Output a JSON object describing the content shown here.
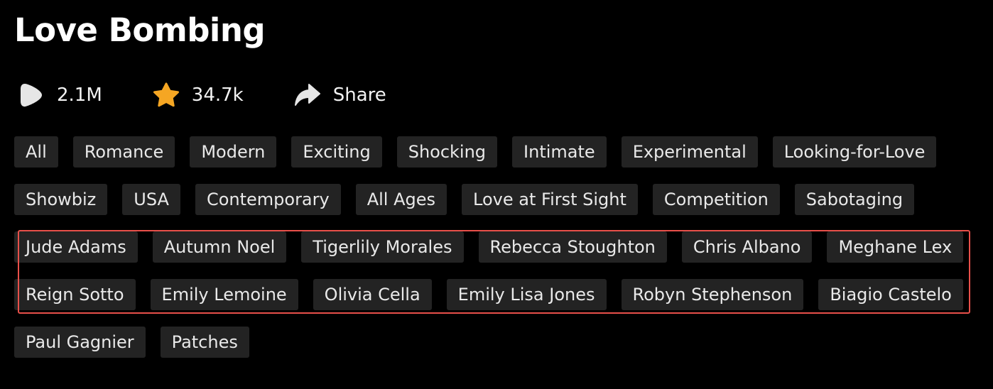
{
  "title": "Love Bombing",
  "stats": {
    "plays": {
      "icon": "play-icon",
      "value": "2.1M"
    },
    "favorites": {
      "icon": "star-icon",
      "value": "34.7k",
      "color": "#f5a623"
    },
    "share": {
      "icon": "share-icon",
      "label": "Share"
    }
  },
  "tag_rows": [
    [
      "All",
      "Romance",
      "Modern",
      "Exciting",
      "Shocking",
      "Intimate",
      "Experimental",
      "Looking-for-Love"
    ],
    [
      "Showbiz",
      "USA",
      "Contemporary",
      "All Ages",
      "Love at First Sight",
      "Competition",
      "Sabotaging"
    ],
    [
      "Jude Adams",
      "Autumn Noel",
      "Tigerlily Morales",
      "Rebecca Stoughton",
      "Chris Albano",
      "Meghane Lex"
    ],
    [
      "Reign Sotto",
      "Emily Lemoine",
      "Olivia Cella",
      "Emily Lisa Jones",
      "Robyn Stephenson",
      "Biagio Castelo"
    ],
    [
      "Paul Gagnier",
      "Patches"
    ]
  ],
  "highlight": {
    "rows": [
      2,
      3
    ],
    "color": "#e8504a"
  },
  "colors": {
    "background": "#000000",
    "tag_background": "#232323",
    "tag_text": "#e9e9e9",
    "accent_star": "#f5a623"
  }
}
